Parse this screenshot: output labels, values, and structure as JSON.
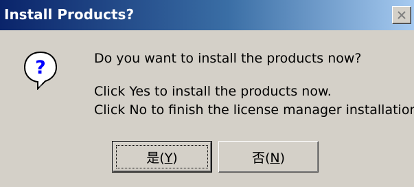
{
  "window": {
    "title": "Install Products?",
    "close_icon": "close-icon"
  },
  "icon": "question-icon",
  "message": {
    "question": "Do you want to install the products now?",
    "yes_line": "Click Yes to install the products now.",
    "no_line": "Click No to finish the license manager installation."
  },
  "buttons": {
    "yes": {
      "label_prefix": "是(",
      "accel": "Y",
      "label_suffix": ")"
    },
    "no": {
      "label_prefix": "否(",
      "accel": "N",
      "label_suffix": ")"
    }
  },
  "colors": {
    "title_start": "#0a246a",
    "title_end": "#a6caf0",
    "face": "#d4d0c8"
  }
}
